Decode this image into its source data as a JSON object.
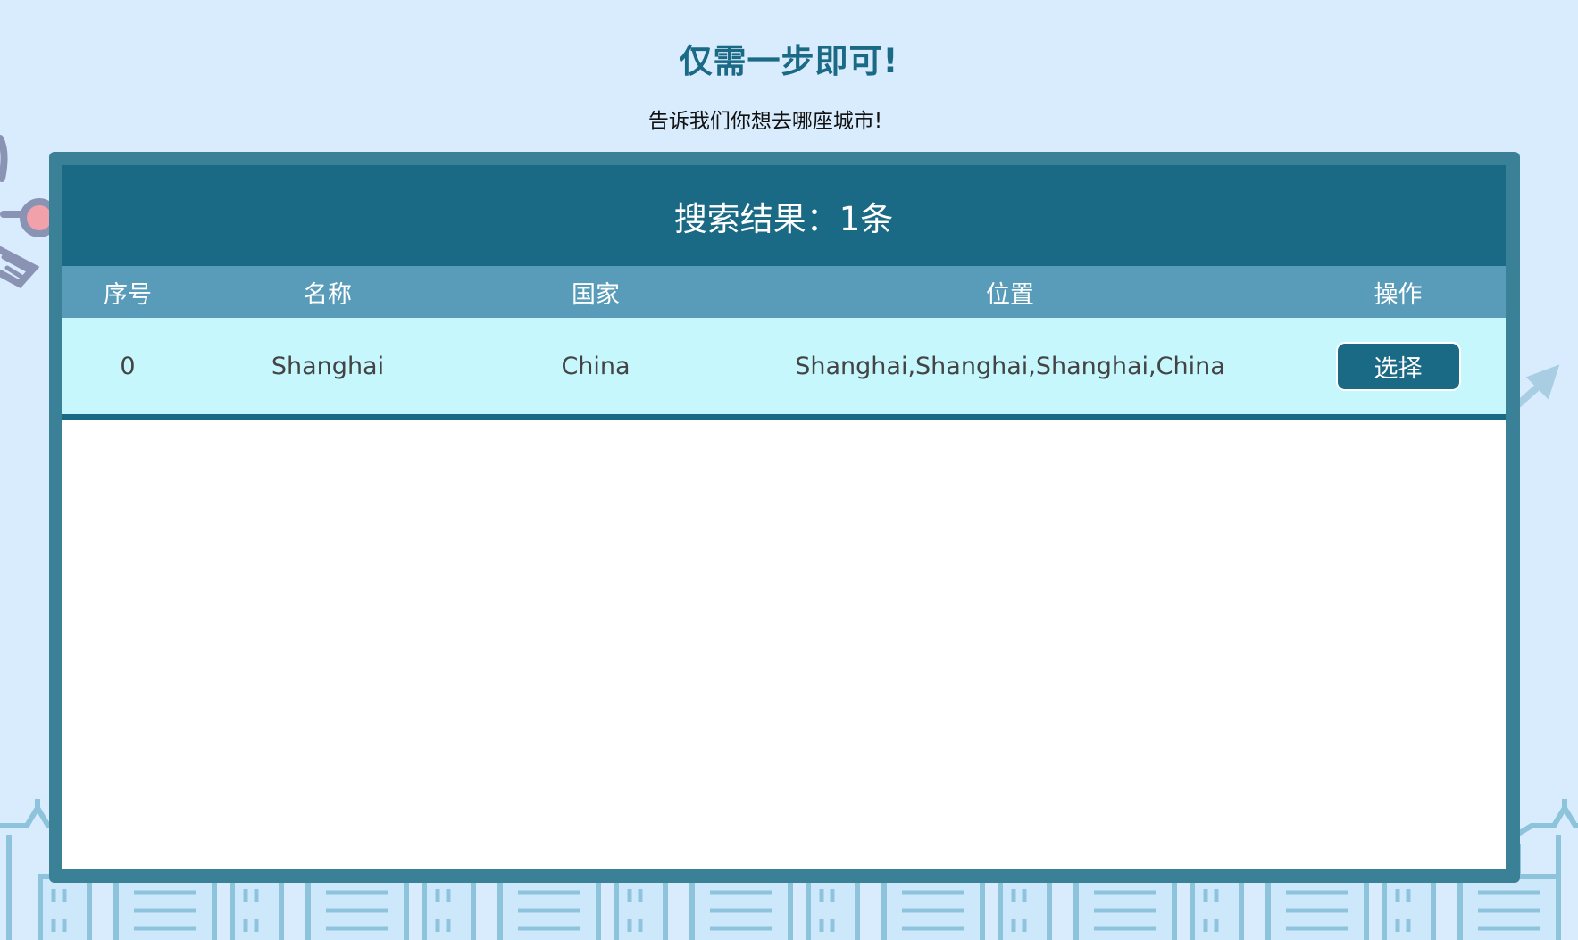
{
  "page": {
    "heading": "仅需一步即可!",
    "subheading": "告诉我们你想去哪座城市!"
  },
  "results": {
    "summary": "搜索结果：1条"
  },
  "table": {
    "columns": [
      "序号",
      "名称",
      "国家",
      "位置",
      "操作"
    ],
    "rows": [
      {
        "index": "0",
        "name": "Shanghai",
        "country": "China",
        "location": "Shanghai,Shanghai,Shanghai,China",
        "action_label": "选择"
      }
    ]
  },
  "colors": {
    "background": "#d9ecfd",
    "primary": "#1a6985",
    "panel_border": "#3a8097",
    "header_row": "#589cba",
    "data_row": "#c5f7fd",
    "buildings": "#8ec3dc"
  }
}
